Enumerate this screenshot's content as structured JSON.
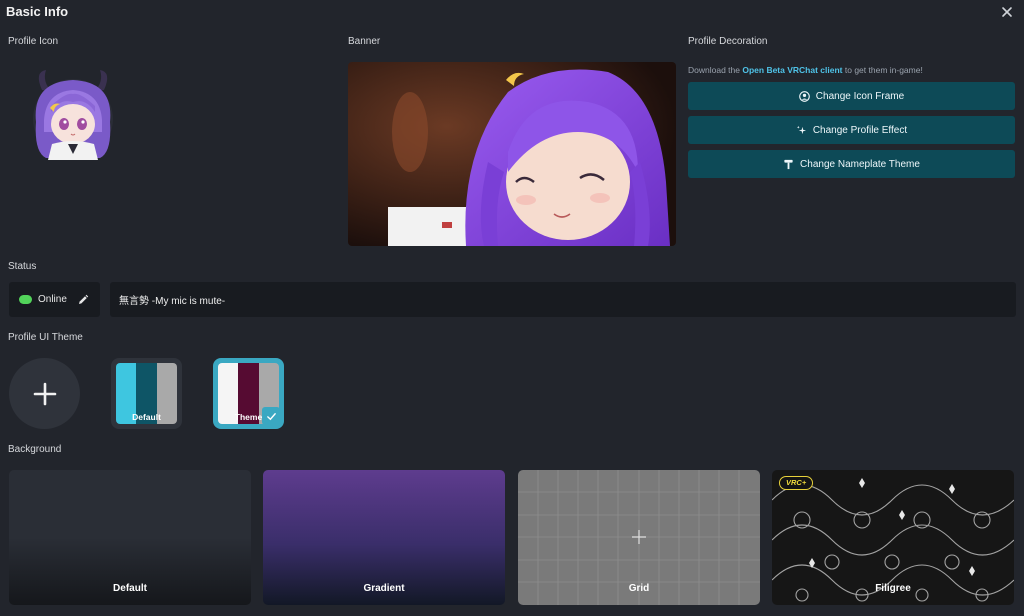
{
  "dialog": {
    "title": "Basic Info"
  },
  "sections": {
    "profile_icon": "Profile Icon",
    "banner": "Banner",
    "profile_decoration": "Profile Decoration",
    "status": "Status",
    "profile_ui_theme": "Profile UI Theme",
    "background": "Background"
  },
  "decoration": {
    "hint_prefix": "Download the",
    "hint_link": "Open Beta VRChat client",
    "hint_suffix": "to get them in-game!",
    "buttons": [
      {
        "label": "Change Icon Frame",
        "icon": "user-circle-icon"
      },
      {
        "label": "Change Profile Effect",
        "icon": "sparkle-icon"
      },
      {
        "label": "Change Nameplate Theme",
        "icon": "nameplate-icon"
      }
    ]
  },
  "status": {
    "state": "Online",
    "state_color": "#52d35a",
    "description": "無言勢 -My mic is mute-"
  },
  "themes": [
    {
      "name": "Default",
      "colors": [
        "#3ec6e0",
        "#0e5566",
        "#a9a9a9"
      ],
      "selected": false
    },
    {
      "name": "Theme",
      "colors": [
        "#f5f5f5",
        "#560b32",
        "#a9a9a9"
      ],
      "selected": true
    }
  ],
  "backgrounds": [
    {
      "name": "Default"
    },
    {
      "name": "Gradient"
    },
    {
      "name": "Grid"
    },
    {
      "name": "Filigree",
      "badge": "VRC+"
    }
  ],
  "colors": {
    "accent": "#0d4a57",
    "selected_border": "#3aa8c2",
    "link": "#4fc3e8"
  }
}
